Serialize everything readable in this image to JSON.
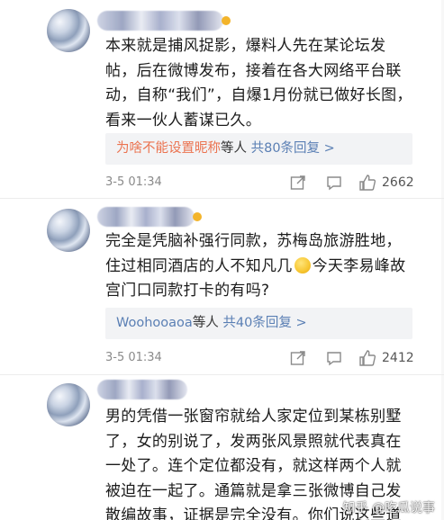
{
  "comments": [
    {
      "text_lines": [
        "本来就是捕风捉影，爆料人先在某论坛发",
        "帖，后在微博发布，接着在各大网络平台联",
        "动，自称“我们”，自爆1月份就已做好长图，",
        "看来一伙人蓄谋已久。"
      ],
      "reply_user": "为啥不能设置昵称",
      "reply_mid": "等人",
      "reply_link": "共80条回复 >",
      "time": "3-5 01:34",
      "likes": "2662"
    },
    {
      "text_lines": [
        "完全是凭脑补强行同款，苏梅岛旅游胜地，",
        "住过相同酒店的人不知凡几",
        "今天李易峰故",
        "宫门口同款打卡的有吗?"
      ],
      "reply_user": "Woohooaoa",
      "reply_mid": "等人",
      "reply_link": "共40条回复 >",
      "time": "3-5 01:34",
      "likes": "2412"
    },
    {
      "text_lines": [
        "男的凭借一张窗帘就给人家定位到某栋别墅",
        "了，女的别说了，发两张风景照就代表真在",
        "一处了。连个定位都没有，就这样两个人就",
        "被迫在一起了。通篇就是拿三张微博自己发",
        "散编故事，证据是完全没有。你们说这些道"
      ]
    }
  ],
  "watermark": "知乎 @吃瓜说事",
  "icons": {
    "share": "share-icon",
    "comment": "comment-icon",
    "like": "thumbs-up-icon",
    "emoji": "smirk-emoji-icon"
  },
  "colors": {
    "reply_user": "#eb7350",
    "reply_link": "#5a7fb4",
    "reply_bg": "#f2f3f5"
  }
}
